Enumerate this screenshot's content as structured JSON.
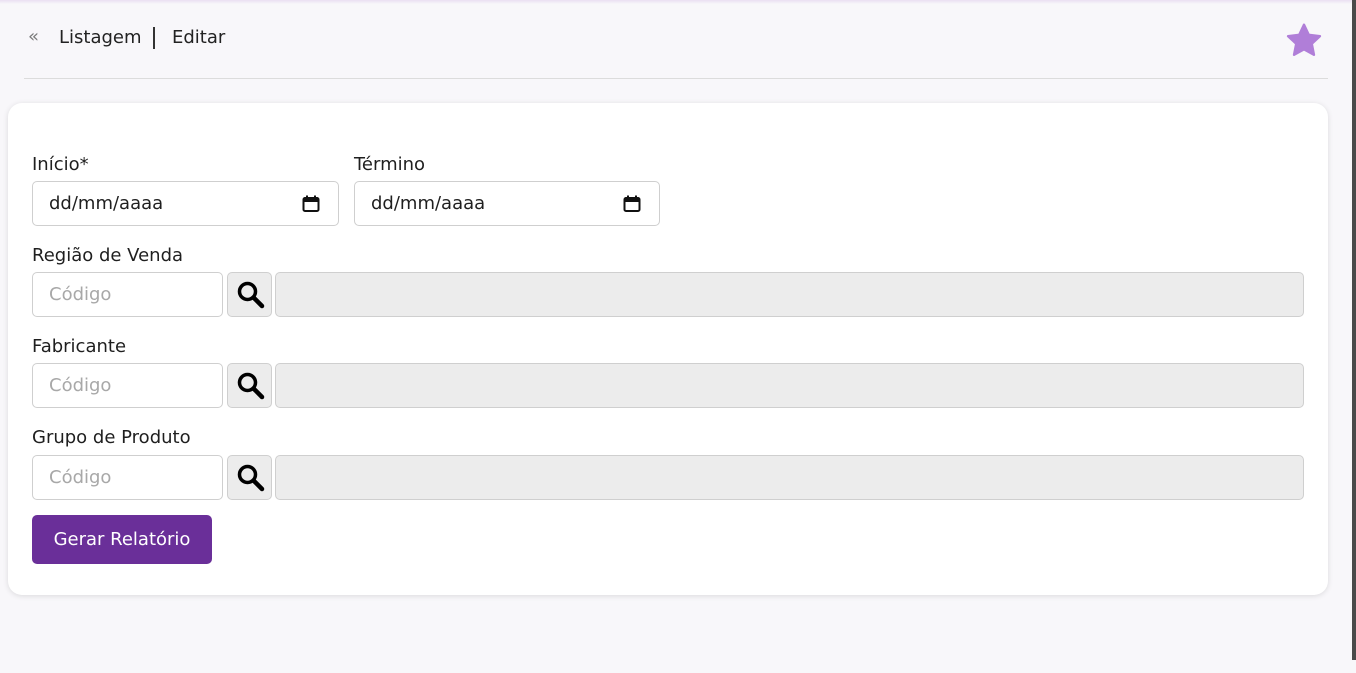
{
  "header": {
    "back_icon": "«",
    "breadcrumb_list": "Listagem",
    "breadcrumb_edit": "Editar",
    "favorite_icon": "star-icon",
    "favorite_color": "#b07ed8"
  },
  "form": {
    "start_label": "Início*",
    "start_value": "dd/mm/aaaa",
    "end_label": "Término",
    "end_value": "dd/mm/aaaa",
    "region_label": "Região de Venda",
    "region_placeholder": "Código",
    "manufacturer_label": "Fabricante",
    "manufacturer_placeholder": "Código",
    "product_group_label": "Grupo de Produto",
    "product_group_placeholder": "Código",
    "submit_label": "Gerar Relatório"
  },
  "colors": {
    "primary": "#6a2f99",
    "readonly_bg": "#ececec"
  }
}
